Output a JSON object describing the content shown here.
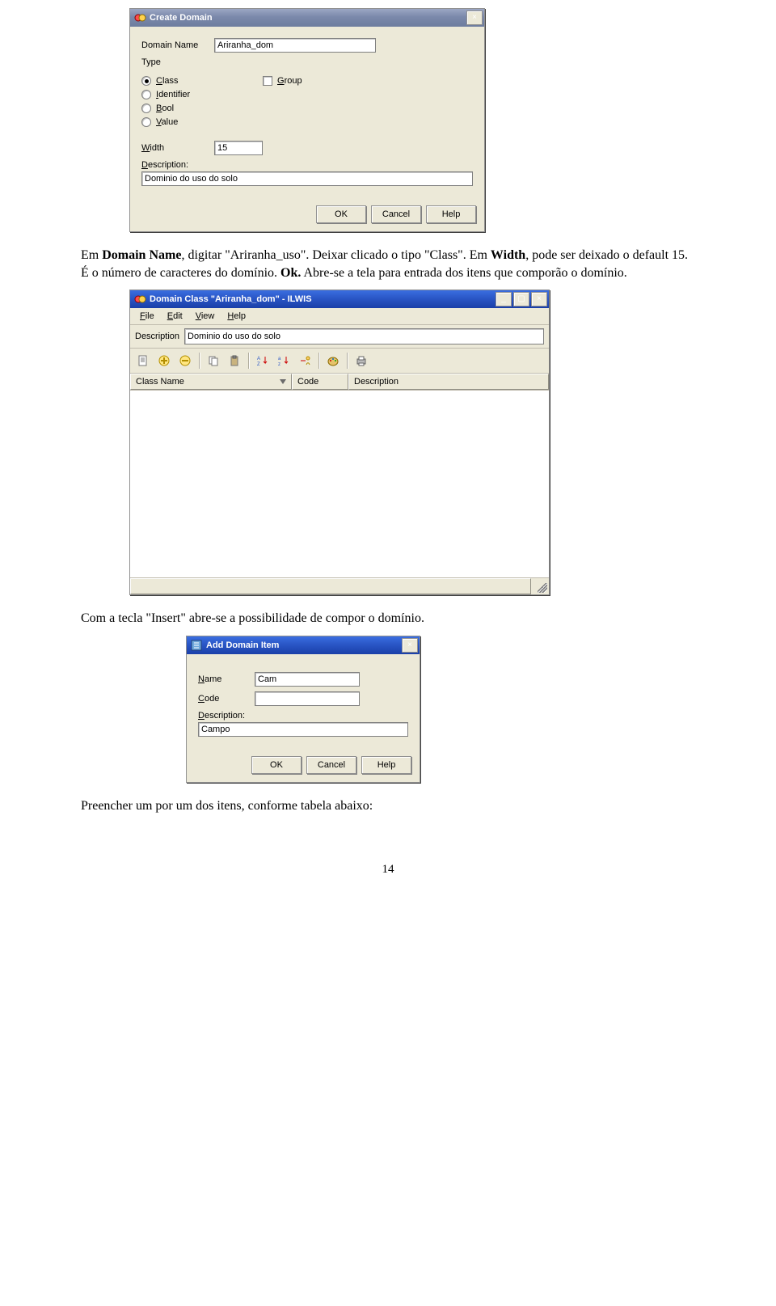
{
  "create_domain": {
    "title": "Create Domain",
    "close_glyph": "×",
    "labels": {
      "domain_name": "Domain Name",
      "type": "Type",
      "width": "Width",
      "description": "Description:"
    },
    "fields": {
      "domain_name": "Ariranha_dom",
      "width": "15",
      "description": "Dominio do uso do solo"
    },
    "type_options": {
      "class": "Class",
      "identifier": "Identifier",
      "bool": "Bool",
      "value": "Value",
      "group": "Group"
    },
    "buttons": {
      "ok": "OK",
      "cancel": "Cancel",
      "help": "Help"
    }
  },
  "para1_parts": {
    "a": "Em ",
    "b": "Domain Name",
    "c": ", digitar \"Ariranha_uso\". Deixar clicado o tipo \"Class\". Em ",
    "d": "Width",
    "e": ", pode ser deixado o default 15. É o número de caracteres do domínio. ",
    "f": "Ok.",
    "g": " Abre-se a tela para entrada dos itens que comporão o domínio."
  },
  "ilwis": {
    "title": "Domain Class \"Ariranha_dom\" - ILWIS",
    "menus": {
      "file": "File",
      "edit": "Edit",
      "view": "View",
      "help": "Help"
    },
    "desc_label": "Description",
    "desc_value": "Dominio do uso do solo",
    "columns": {
      "classname": "Class Name",
      "code": "Code",
      "description": "Description"
    },
    "icons": {
      "edit": "edit-icon",
      "add": "add-icon",
      "remove": "remove-icon",
      "copy": "copy-icon",
      "paste": "paste-icon",
      "sort_az_down": "sort-az-down-icon",
      "sort_az_up": "sort-az-up-icon",
      "sort_manual": "sort-manual-icon",
      "palette": "palette-icon",
      "print": "print-icon"
    }
  },
  "para2": "Com a tecla \"Insert\" abre-se a possibilidade de compor o domínio.",
  "add_item": {
    "title": "Add Domain Item",
    "close_glyph": "×",
    "labels": {
      "name": "Name",
      "code": "Code",
      "description": "Description:"
    },
    "fields": {
      "name": "Cam",
      "code": "",
      "description": "Campo"
    },
    "buttons": {
      "ok": "OK",
      "cancel": "Cancel",
      "help": "Help"
    }
  },
  "para3": " Preencher um por um dos itens, conforme tabela abaixo:",
  "page_number": "14"
}
